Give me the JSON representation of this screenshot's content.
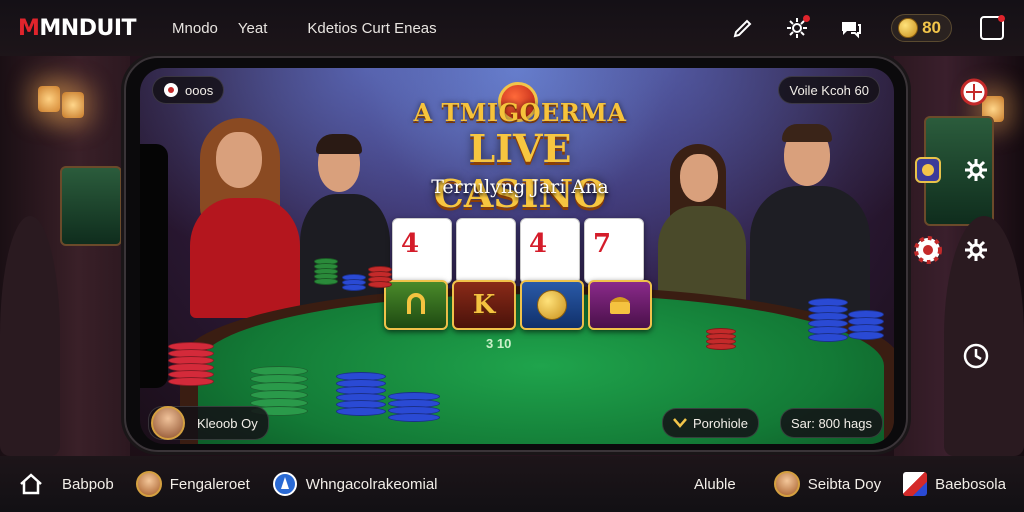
{
  "header": {
    "logo_first": "M",
    "logo_rest": "MNDUIT",
    "nav": [
      "Mnodo",
      "Yeat",
      "Kdetios Curt Eneas"
    ],
    "coin_balance": "80"
  },
  "game": {
    "top_left_pill": "ooos",
    "top_right_pill": "Voile  Kcoh 60",
    "title_line1": "A TMIGOERMA",
    "title_line2": "LIVE CASINO",
    "subtitle": "Terrulyng Jari Ana",
    "cards": [
      "4",
      "",
      "4",
      "7"
    ],
    "tiles": [
      "",
      "K",
      "",
      ""
    ],
    "felt_labels": [
      "3 10",
      "",
      ""
    ],
    "player_pill": "Kleoob Oy",
    "action_left": "Porohiole",
    "action_right": "Sar: 800 hags"
  },
  "footer": {
    "items": [
      "Babpob",
      "Fengaleroet",
      "Whngacolrakeomial"
    ],
    "right_items": [
      "Aluble",
      "Seibta Doy",
      "Baebosola"
    ]
  },
  "colors": {
    "accent_red": "#e0242c",
    "gold": "#f6c33c",
    "felt_green": "#1fa44c"
  }
}
